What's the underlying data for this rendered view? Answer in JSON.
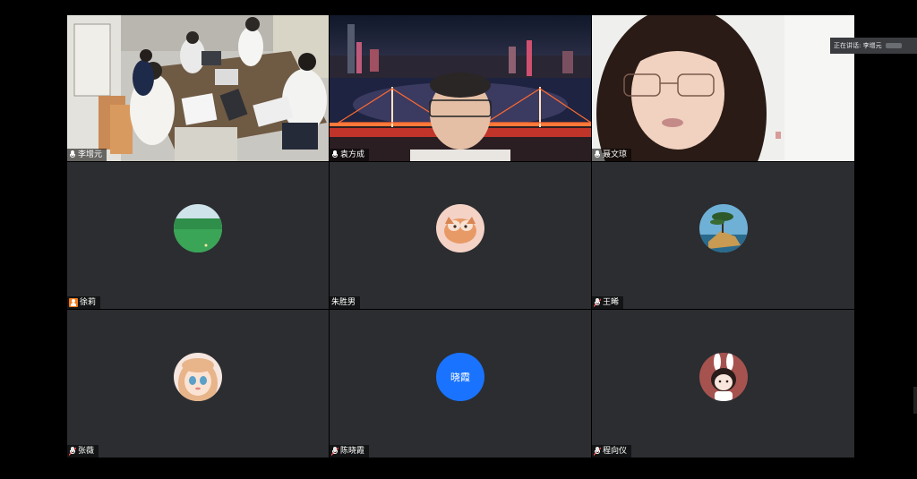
{
  "speaking": {
    "label": "正在讲话:",
    "name": "李增元"
  },
  "tiles": [
    {
      "name": "李增元",
      "kind": "video",
      "active": true
    },
    {
      "name": "袁方成",
      "kind": "video"
    },
    {
      "name": "聂文琼",
      "kind": "video"
    },
    {
      "name": "徐莉",
      "kind": "avatar",
      "icon": "host-icon"
    },
    {
      "name": "朱胜男",
      "kind": "avatar"
    },
    {
      "name": "王晞",
      "kind": "avatar",
      "icon": "muted-mic-icon"
    },
    {
      "name": "张薇",
      "kind": "avatar",
      "icon": "muted-mic-icon"
    },
    {
      "name": "陈晓霞",
      "kind": "avatar",
      "icon": "muted-mic-icon",
      "avatar_text": "晓霞"
    },
    {
      "name": "程向仪",
      "kind": "avatar",
      "icon": "muted-mic-icon"
    }
  ],
  "colors": {
    "tile_bg": "#2b2d30",
    "active_border": "#3fb87a",
    "text_avatar_bg": "#1a73ff",
    "host_badge": "#f07a1c"
  }
}
